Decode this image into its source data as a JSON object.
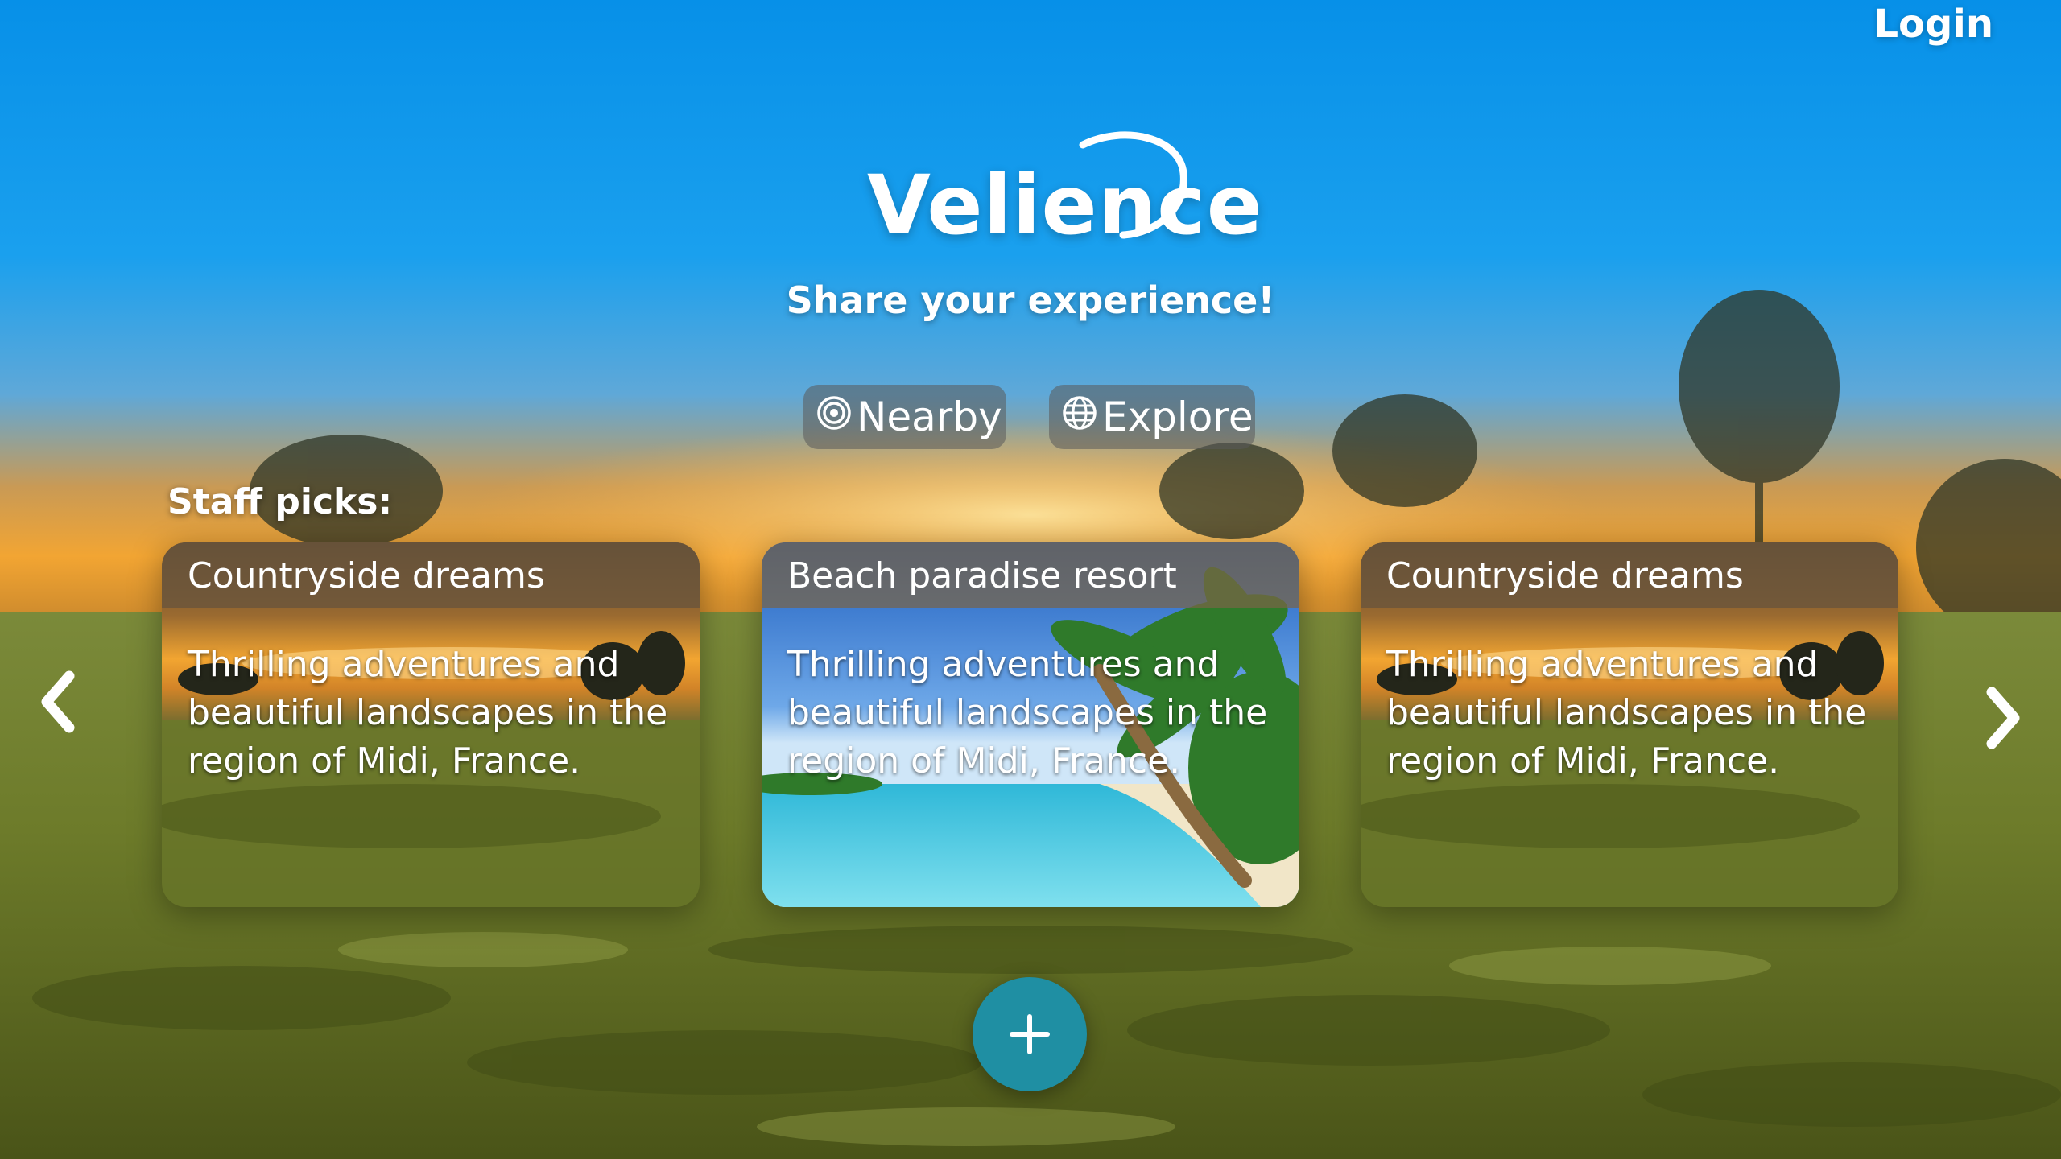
{
  "app": {
    "brand": "Velience",
    "tagline": "Share your experience!",
    "login_label": "Login"
  },
  "nav": {
    "buttons": [
      {
        "label": "Nearby",
        "icon": "target-icon"
      },
      {
        "label": "Explore",
        "icon": "globe-icon"
      }
    ]
  },
  "staff_picks": {
    "title": "Staff picks:",
    "cards": [
      {
        "title": "Countryside dreams",
        "description": "Thrilling adventures and beautiful landscapes in the region of Midi, France.",
        "image": "countryside-sunset-image"
      },
      {
        "title": "Beach paradise resort",
        "description": "Thrilling adventures and beautiful landscapes in the region of Midi, France.",
        "image": "tropical-beach-image"
      },
      {
        "title": "Countryside dreams",
        "description": "Thrilling adventures and beautiful landscapes in the region of Midi, France.",
        "image": "countryside-sunset-image"
      }
    ],
    "prev_icon": "chevron-left-icon",
    "next_icon": "chevron-right-icon"
  },
  "add_button": {
    "icon": "plus-icon"
  },
  "colors": {
    "sky_top": "#0a8fe6",
    "sky_horizon": "#f0a33a",
    "grass": "#6f7d2c",
    "fab": "#1f8fa3",
    "pill_bg": "#5a5a5a"
  }
}
